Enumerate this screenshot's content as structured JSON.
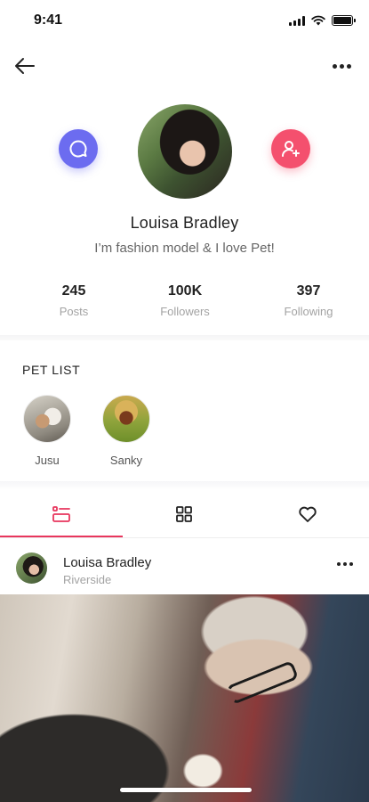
{
  "status_bar": {
    "time": "9:41",
    "icons": [
      "signal-icon",
      "wifi-icon",
      "battery-icon"
    ]
  },
  "nav": {
    "back_icon": "back-arrow-icon",
    "more_icon": "more-horizontal-icon"
  },
  "profile": {
    "name": "Louisa Bradley",
    "bio": "I’m fashion model & I love Pet!",
    "message_icon": "chat-bubble-icon",
    "follow_icon": "add-user-icon",
    "stats": [
      {
        "value": "245",
        "label": "Posts"
      },
      {
        "value": "100K",
        "label": "Followers"
      },
      {
        "value": "397",
        "label": "Following"
      }
    ]
  },
  "pet_list": {
    "title": "PET LIST",
    "pets": [
      {
        "name": "Jusu"
      },
      {
        "name": "Sanky"
      }
    ]
  },
  "tabs": [
    {
      "icon": "list-view-icon",
      "active": true
    },
    {
      "icon": "grid-view-icon",
      "active": false
    },
    {
      "icon": "heart-icon",
      "active": false
    }
  ],
  "post": {
    "author": "Louisa Bradley",
    "location": "Riverside",
    "more_icon": "more-horizontal-icon"
  },
  "colors": {
    "accent": "#e8365d",
    "message_button": "#6c6cf0",
    "follow_button": "#f4506e",
    "muted_text": "#a3a3a3"
  }
}
